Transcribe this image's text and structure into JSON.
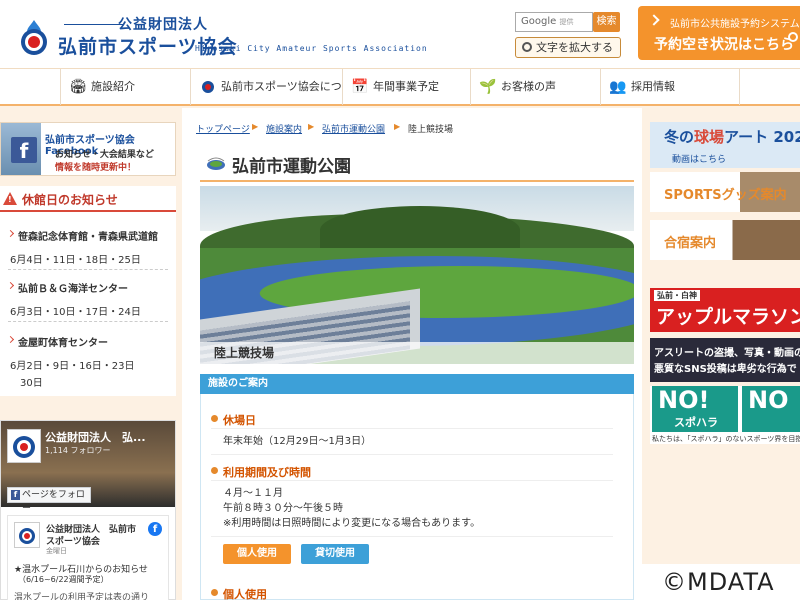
{
  "header": {
    "org_sub": "公益財団法人",
    "org_name": "弘前市スポーツ協会",
    "org_en": "Hirosaki City Amateur Sports Association",
    "google_label": "Google",
    "google_small": "提供",
    "search_label": "検索",
    "enlarge_label": "文字を拡大する",
    "reserve_small": "弘前市公共施設予約システム",
    "reserve_big": "予約空き状況はこちら"
  },
  "nav": {
    "items": [
      {
        "label": "施設紹介",
        "icon": "building-icon"
      },
      {
        "label": "弘前市スポーツ協会について",
        "icon": "logo-icon"
      },
      {
        "label": "年間事業予定",
        "icon": "calendar-icon"
      },
      {
        "label": "お客様の声",
        "icon": "plant-icon"
      },
      {
        "label": "採用情報",
        "icon": "people-icon"
      }
    ]
  },
  "left": {
    "fb_banner": {
      "title": "弘前市スポーツ協会 Facebook",
      "line1": "お知らせ・大会結果など",
      "line2": "情報を随時更新中！"
    },
    "closed": {
      "title": "休館日のお知らせ",
      "items": [
        {
          "name": "笹森記念体育館・青森県武道館",
          "dates": "6月4日・11日・18日・25日"
        },
        {
          "name": "弘前Ｂ＆Ｇ海洋センター",
          "dates": "6月3日・10日・17日・24日"
        },
        {
          "name": "金屋町体育センター",
          "dates1": "6月2日・9日・16日・23日",
          "dates2": "30日"
        }
      ]
    },
    "fb_widget": {
      "page_name": "公益財団法人　弘...",
      "followers": "1,114 フォロワー",
      "follow_label": "ページをフォロー",
      "post_name1": "公益財団法人　弘前市",
      "post_name2": "スポーツ協会",
      "post_date": "金曜日",
      "post_text1": "★温水プール石川からのお知らせ",
      "post_text2": "（6/16~6/22週間予定）",
      "post_text3": "温水プールの利用予定は表の通り"
    }
  },
  "main": {
    "breadcrumb": [
      "トップページ",
      "施設案内",
      "弘前市運動公園",
      "陸上競技場"
    ],
    "title": "弘前市運動公園",
    "photo_caption": "陸上競技場",
    "info_header": "施設のご案内",
    "sections": [
      {
        "heading": "休場日",
        "lines": [
          "年末年始（12月29日〜1月3日）"
        ]
      },
      {
        "heading": "利用期間及び時間",
        "lines": [
          "４月〜１１月",
          "午前８時３０分〜午後５時",
          "※利用時間は日照時間により変更になる場合もあります。"
        ]
      }
    ],
    "btn_personal": "個人使用",
    "btn_private": "貸切使用",
    "next_section": "個人使用"
  },
  "right": {
    "b1_title_a": "冬の",
    "b1_title_b": "球場",
    "b1_title_c": "アート 202",
    "b1_sub": "動画はこちら",
    "b2": "SPORTSグッズ案内",
    "b3": "合宿案内",
    "b4_small": "弘前・白神",
    "b4_big": "アップルマラソン",
    "b5_line1": "アスリートの盗撮、写真・動画の",
    "b5_line2": "悪質なSNS投稿は卑劣な行為で",
    "b6_no": "NO!",
    "b6_sub": "スポハラ",
    "b6_no2": "NO",
    "b6_bottom": "私たちは、「スポハラ」のないスポーツ界を目指"
  },
  "copyright": "©MDATA"
}
